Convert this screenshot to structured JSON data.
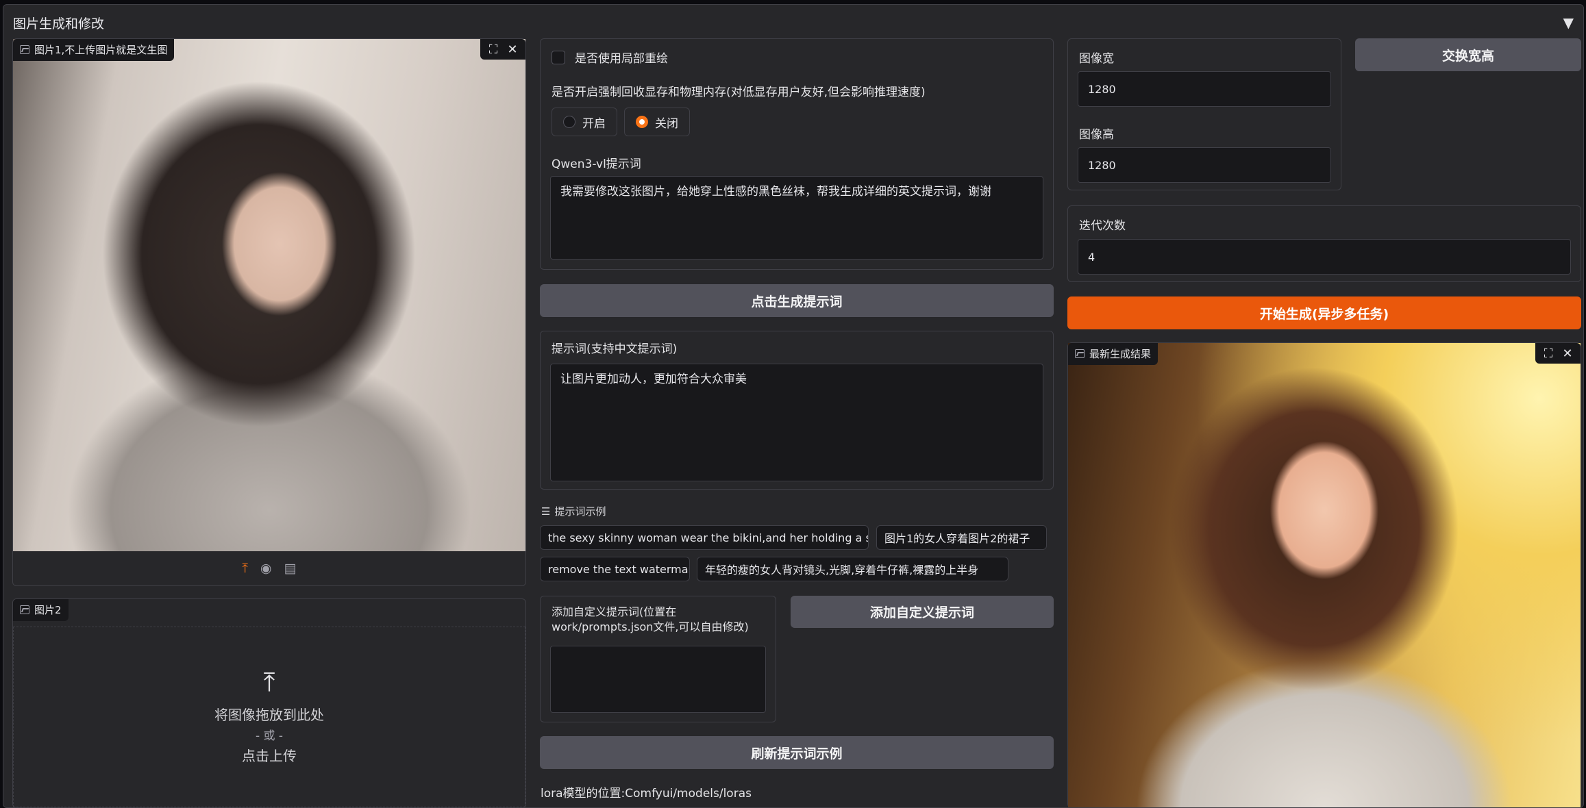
{
  "accordion": {
    "title": "图片生成和修改",
    "toggle_glyph": "▼"
  },
  "image1": {
    "label": "图片1,不上传图片就是文生图",
    "fullscreen_glyph": "⛶",
    "close_glyph": "✕"
  },
  "image1_tools": {
    "upload_glyph": "⤒",
    "webcam_glyph": "◉",
    "clipboard_glyph": "▤"
  },
  "image2": {
    "label": "图片2",
    "drop_text": "将图像拖放到此处",
    "or_text": "- 或 -",
    "click_text": "点击上传",
    "upload_glyph": "⤒"
  },
  "inpaint": {
    "label": "是否使用局部重绘",
    "checked": false
  },
  "memory": {
    "label": "是否开启强制回收显存和物理内存(对低显存用户友好,但会影响推理速度)",
    "options": [
      "开启",
      "关闭"
    ],
    "selected": "关闭"
  },
  "qwen": {
    "label": "Qwen3-vl提示词",
    "value": "我需要修改这张图片，给她穿上性感的黑色丝袜，帮我生成详细的英文提示词，谢谢"
  },
  "generate_prompt_button": "点击生成提示词",
  "prompt": {
    "label": "提示词(支持中文提示词)",
    "value": "让图片更加动人，更加符合大众审美"
  },
  "examples": {
    "label": "提示词示例",
    "items": [
      "the sexy skinny woman wear the bikini,and her holding a sign...",
      "图片1的女人穿着图片2的裙子",
      "remove the text watermark",
      "年轻的瘦的女人背对镜头,光脚,穿着牛仔裤,裸露的上半身"
    ]
  },
  "custom_prompt": {
    "label": "添加自定义提示词(位置在work/prompts.json文件,可以自由修改)",
    "value": ""
  },
  "add_custom_button": "添加自定义提示词",
  "refresh_button": "刷新提示词示例",
  "lora_text": "lora模型的位置:Comfyui/models/loras",
  "width": {
    "label": "图像宽",
    "value": "1280"
  },
  "height": {
    "label": "图像高",
    "value": "1280"
  },
  "swap_button": "交换宽高",
  "steps": {
    "label": "迭代次数",
    "value": "4"
  },
  "start_button": "开始生成(异步多任务)",
  "result": {
    "label": "最新生成结果",
    "fullscreen_glyph": "⛶",
    "close_glyph": "✕"
  },
  "colors": {
    "accent": "#ea580c",
    "panel": "#27272a",
    "input_bg": "#18181b",
    "button": "#52525b"
  }
}
